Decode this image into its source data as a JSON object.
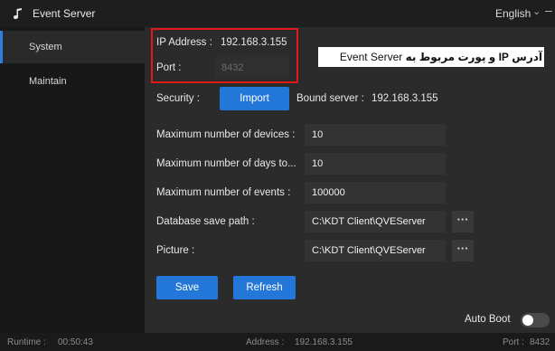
{
  "window": {
    "title": "Event Server"
  },
  "titlebar": {
    "language": "English",
    "language_chevron": "chevron-down-icon",
    "window_control": "minimize-icon"
  },
  "sidebar": {
    "items": [
      {
        "label": "System",
        "active": true
      },
      {
        "label": "Maintain",
        "active": false
      }
    ]
  },
  "system": {
    "ip_label": "IP Address :",
    "ip_value": "192.168.3.155",
    "port_label": "Port :",
    "port_value": "8432",
    "security_label": "Security :",
    "import_label": "Import",
    "bound_server_label": "Bound server :",
    "bound_server_value": "192.168.3.155",
    "max_devices_label": "Maximum number of devices :",
    "max_devices_value": "10",
    "max_days_label": "Maximum number of days to...",
    "max_days_value": "10",
    "max_events_label": "Maximum number of events :",
    "max_events_value": "100000",
    "db_path_label": "Database save path :",
    "db_path_value": "C:\\KDT Client\\QVEServer",
    "picture_label": "Picture :",
    "picture_value": "C:\\KDT Client\\QVEServer",
    "browse_label": "···",
    "save_label": "Save",
    "refresh_label": "Refresh",
    "auto_boot_label": "Auto Boot",
    "auto_boot_state": "off"
  },
  "annotation": {
    "text_rtl": "آدرس IP و پورت مربوط به",
    "text_en": "Event Server"
  },
  "statusbar": {
    "runtime_label": "Runtime :",
    "runtime_value": "00:50:43",
    "address_label": "Address :",
    "address_value": "192.168.3.155",
    "port_label": "Port :",
    "port_value": "8432"
  },
  "colors": {
    "accent": "#2377d8",
    "highlight": "#e11919",
    "background": "#2b2b2b",
    "sidebar": "#181818"
  }
}
